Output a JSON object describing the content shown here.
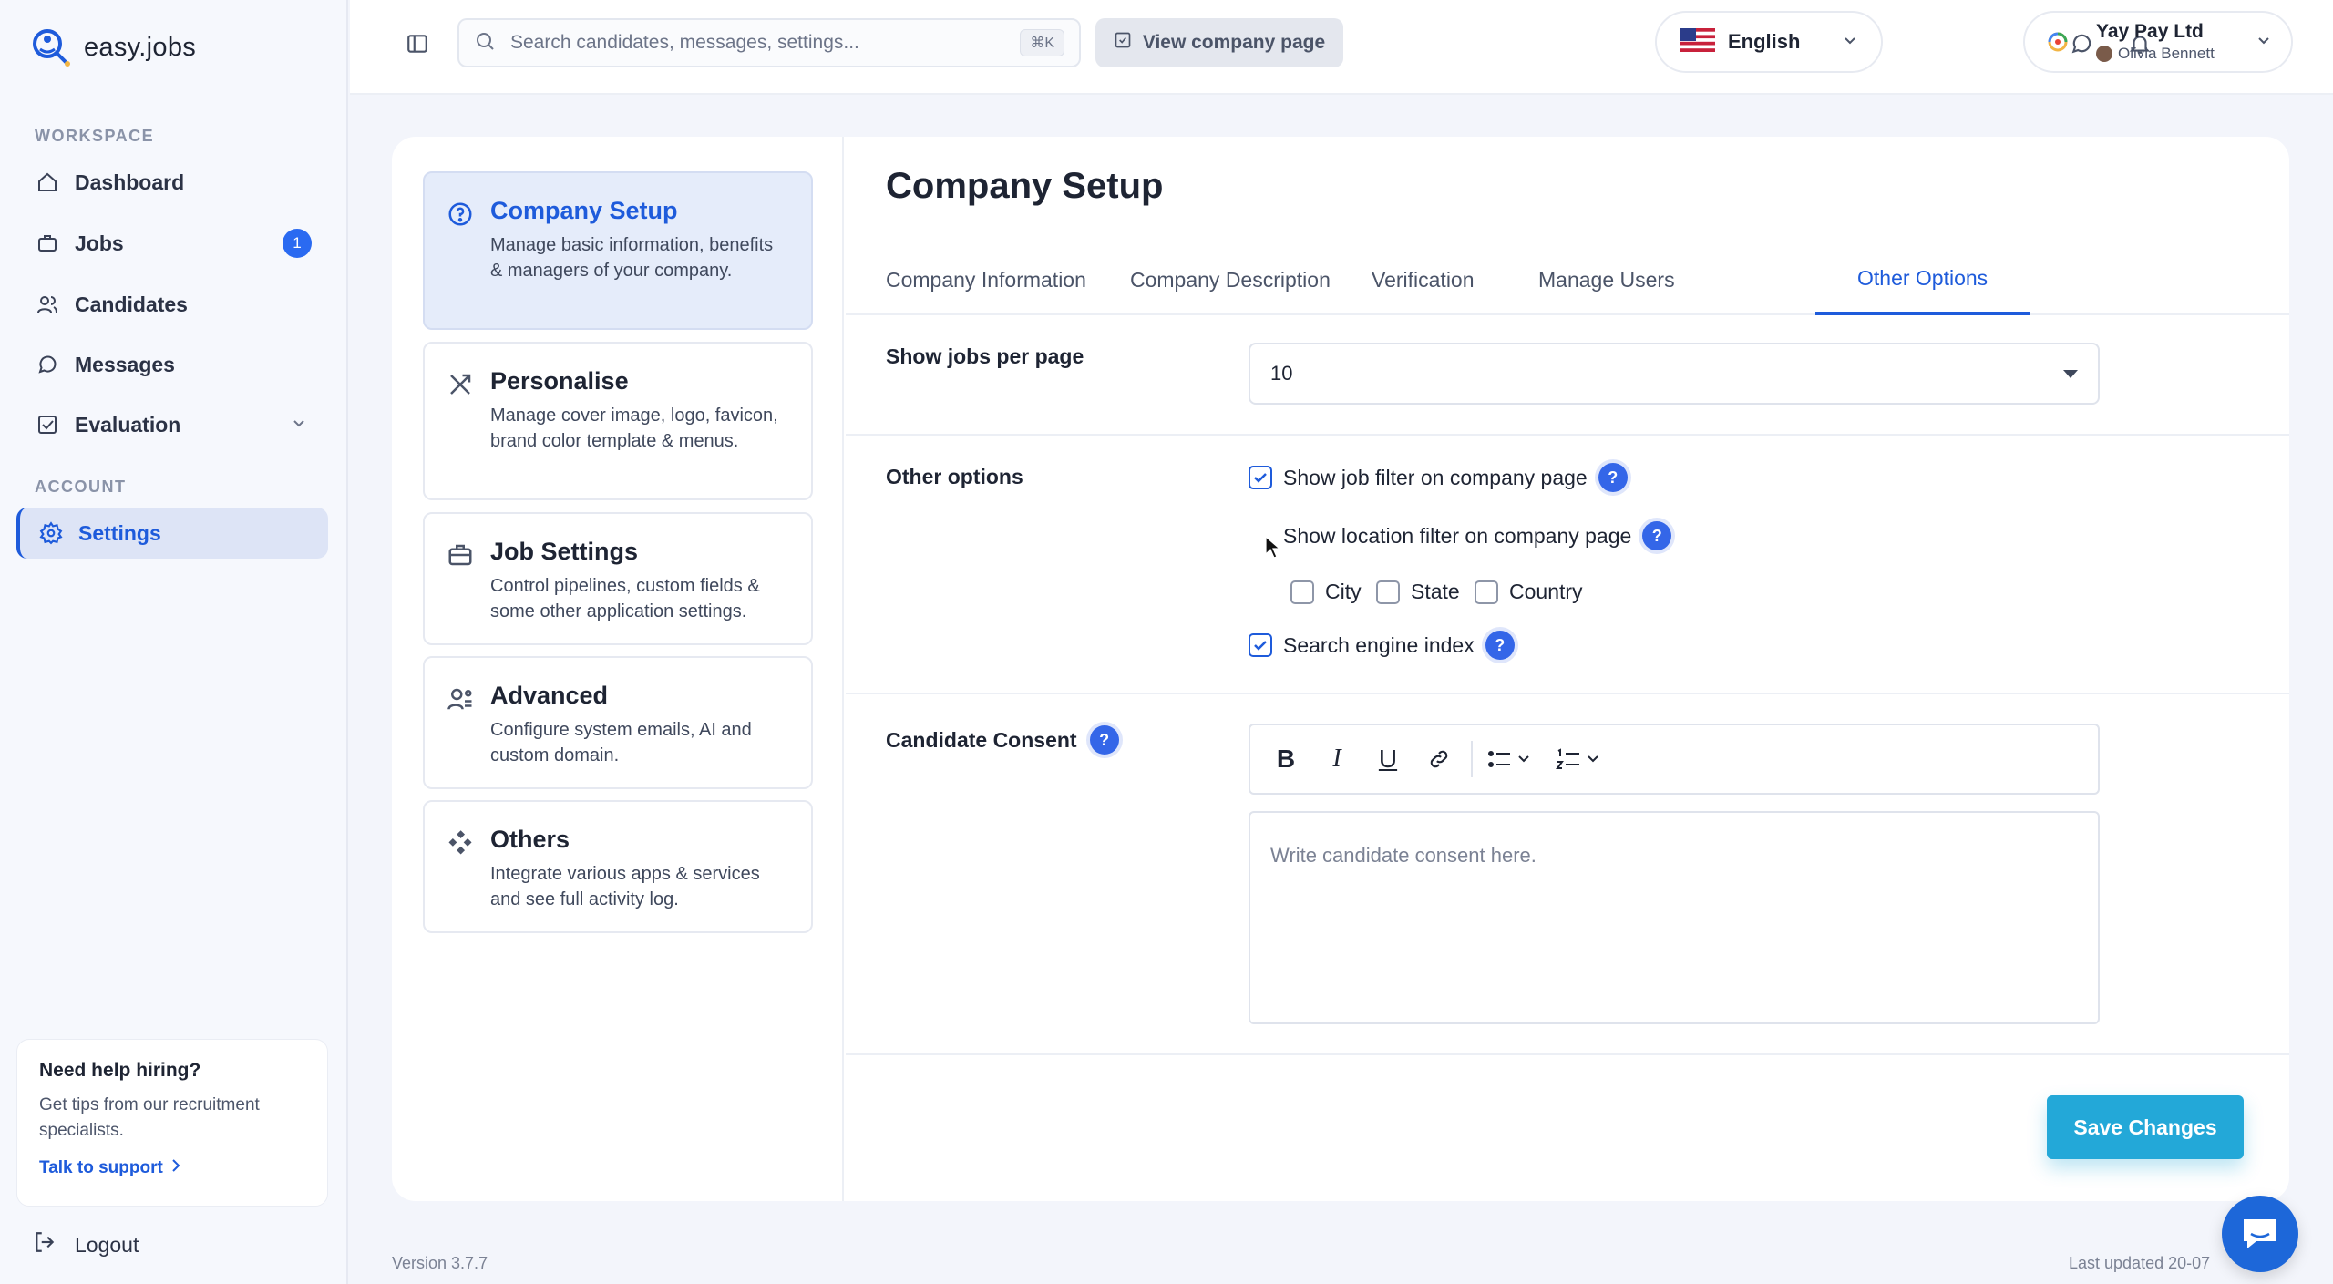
{
  "app": {
    "name": "easy.jobs"
  },
  "sidebar": {
    "workspace_label": "WORKSPACE",
    "account_label": "ACCOUNT",
    "items": [
      {
        "label": "Dashboard",
        "icon": "home-icon"
      },
      {
        "label": "Jobs",
        "icon": "briefcase-icon",
        "badge": "1"
      },
      {
        "label": "Candidates",
        "icon": "users-icon"
      },
      {
        "label": "Messages",
        "icon": "chat-icon"
      },
      {
        "label": "Evaluation",
        "icon": "checklist-icon"
      },
      {
        "label": "Settings",
        "icon": "gear-icon"
      }
    ],
    "help": {
      "title": "Need help hiring?",
      "text": "Get tips from our recruitment specialists.",
      "link": "Talk to support"
    },
    "logout": "Logout"
  },
  "topbar": {
    "search_placeholder": "Search candidates, messages, settings...",
    "shortcut": "⌘K",
    "view_company": "View company page",
    "language": "English",
    "company": "Yay Pay Ltd",
    "user": "Olivia Bennett"
  },
  "settings_menu": [
    {
      "title": "Company Setup",
      "desc": "Manage basic information, benefits & managers of your company."
    },
    {
      "title": "Personalise",
      "desc": "Manage cover image, logo, favicon, brand color template & menus."
    },
    {
      "title": "Job Settings",
      "desc": "Control pipelines, custom fields & some other application settings."
    },
    {
      "title": "Advanced",
      "desc": "Configure system emails, AI and custom domain."
    },
    {
      "title": "Others",
      "desc": "Integrate various apps & services and see full activity log."
    }
  ],
  "page": {
    "title": "Company Setup",
    "tabs": [
      "Company Information",
      "Company Description",
      "Verification",
      "Manage Users",
      "Other Options"
    ],
    "active_tab": "Other Options",
    "jobs_per_page_label": "Show jobs per page",
    "jobs_per_page_value": "10",
    "other_options_label": "Other options",
    "options": {
      "job_filter": {
        "label": "Show job filter on company page",
        "checked": true
      },
      "location_filter": {
        "label": "Show location filter on company page",
        "checked": false
      },
      "city": {
        "label": "City",
        "checked": false
      },
      "state": {
        "label": "State",
        "checked": false
      },
      "country": {
        "label": "Country",
        "checked": false
      },
      "search_index": {
        "label": "Search engine index",
        "checked": true
      }
    },
    "consent_label": "Candidate Consent",
    "consent_placeholder": "Write candidate consent here.",
    "save_label": "Save Changes"
  },
  "footer": {
    "version": "Version 3.7.7",
    "updated": "Last updated 20-07"
  },
  "colors": {
    "accent": "#1e5bdb",
    "save_button": "#23a8d8",
    "badge": "#2a6af1"
  }
}
